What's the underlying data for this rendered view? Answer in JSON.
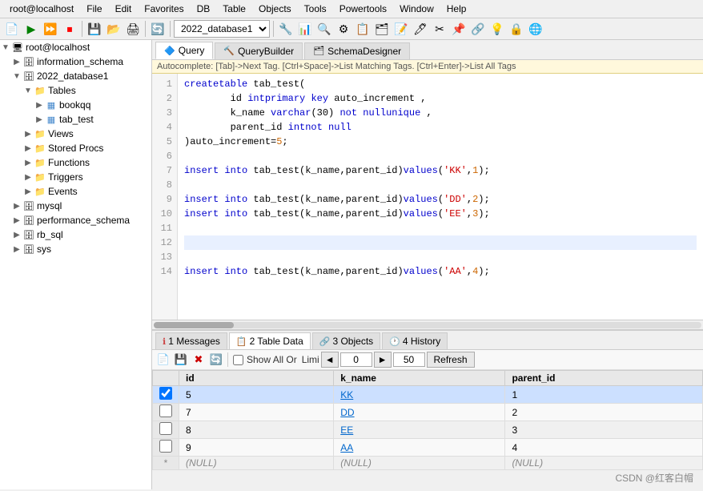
{
  "menubar": {
    "items": [
      "root@localhost",
      "File",
      "Edit",
      "Favorites",
      "DB",
      "Table",
      "Objects",
      "Tools",
      "Powertools",
      "Window",
      "Help"
    ]
  },
  "toolbar": {
    "db_select": "2022_database1"
  },
  "tabs": {
    "query": "Query",
    "query_builder": "QueryBuilder",
    "schema_designer": "SchemaDesigner"
  },
  "autocomplete": "Autocomplete: [Tab]->Next Tag. [Ctrl+Space]->List Matching Tags. [Ctrl+Enter]->List All Tags",
  "code_lines": [
    {
      "num": 1,
      "text": "create table tab_test(",
      "active": false
    },
    {
      "num": 2,
      "text": "        id int primary key auto_increment ,",
      "active": false
    },
    {
      "num": 3,
      "text": "        k_name varchar(30) not null unique ,",
      "active": false
    },
    {
      "num": 4,
      "text": "        parent_id int not null",
      "active": false
    },
    {
      "num": 5,
      "text": ")auto_increment=5;",
      "active": false
    },
    {
      "num": 6,
      "text": "",
      "active": false
    },
    {
      "num": 7,
      "text": "insert into tab_test(k_name,parent_id)values('KK',1);",
      "active": false
    },
    {
      "num": 8,
      "text": "",
      "active": false
    },
    {
      "num": 9,
      "text": "insert into tab_test(k_name,parent_id)values('DD',2);",
      "active": false
    },
    {
      "num": 10,
      "text": "insert into tab_test(k_name,parent_id)values('EE',3);",
      "active": false
    },
    {
      "num": 11,
      "text": "",
      "active": false
    },
    {
      "num": 12,
      "text": "",
      "active": true
    },
    {
      "num": 13,
      "text": "",
      "active": false
    },
    {
      "num": 14,
      "text": "insert into tab_test(k_name,parent_id)values('AA',4);",
      "active": false
    }
  ],
  "sidebar": {
    "items": [
      {
        "id": "root",
        "label": "root@localhost",
        "indent": 0,
        "icon": "server",
        "expanded": true
      },
      {
        "id": "info_schema",
        "label": "information_schema",
        "indent": 1,
        "icon": "db",
        "expanded": false
      },
      {
        "id": "db_2022",
        "label": "2022_database1",
        "indent": 1,
        "icon": "db",
        "expanded": true
      },
      {
        "id": "tables",
        "label": "Tables",
        "indent": 2,
        "icon": "folder",
        "expanded": true
      },
      {
        "id": "bookqq",
        "label": "bookqq",
        "indent": 3,
        "icon": "table",
        "expanded": false
      },
      {
        "id": "tab_test",
        "label": "tab_test",
        "indent": 3,
        "icon": "table",
        "expanded": false
      },
      {
        "id": "views",
        "label": "Views",
        "indent": 2,
        "icon": "folder",
        "expanded": false
      },
      {
        "id": "stored_procs",
        "label": "Stored Procs",
        "indent": 2,
        "icon": "folder",
        "expanded": false
      },
      {
        "id": "functions",
        "label": "Functions",
        "indent": 2,
        "icon": "folder",
        "expanded": false
      },
      {
        "id": "triggers",
        "label": "Triggers",
        "indent": 2,
        "icon": "folder",
        "expanded": false
      },
      {
        "id": "events",
        "label": "Events",
        "indent": 2,
        "icon": "folder",
        "expanded": false
      },
      {
        "id": "mysql",
        "label": "mysql",
        "indent": 1,
        "icon": "db",
        "expanded": false
      },
      {
        "id": "perf_schema",
        "label": "performance_schema",
        "indent": 1,
        "icon": "db",
        "expanded": false
      },
      {
        "id": "rb_sql",
        "label": "rb_sql",
        "indent": 1,
        "icon": "db",
        "expanded": false
      },
      {
        "id": "sys",
        "label": "sys",
        "indent": 1,
        "icon": "db",
        "expanded": false
      }
    ]
  },
  "bottom_tabs": [
    {
      "id": "messages",
      "label": "1 Messages",
      "icon": "ℹ️",
      "active": false
    },
    {
      "id": "table_data",
      "label": "2 Table Data",
      "icon": "📋",
      "active": true
    },
    {
      "id": "objects",
      "label": "3 Objects",
      "icon": "🔗",
      "active": false
    },
    {
      "id": "history",
      "label": "4 History",
      "icon": "🕐",
      "active": false
    }
  ],
  "table_toolbar": {
    "offset_value": "0",
    "limit_value": "50",
    "show_all_label": "Show All Or",
    "limi_label": "Limi",
    "refresh_label": "Refresh"
  },
  "table_data": {
    "columns": [
      "",
      "id",
      "k_name",
      "parent_id"
    ],
    "rows": [
      {
        "id": 5,
        "k_name": "KK",
        "parent_id": 1,
        "selected": true
      },
      {
        "id": 7,
        "k_name": "DD",
        "parent_id": 2,
        "selected": false
      },
      {
        "id": 8,
        "k_name": "EE",
        "parent_id": 3,
        "selected": false
      },
      {
        "id": 9,
        "k_name": "AA",
        "parent_id": 4,
        "selected": false
      }
    ],
    "star_row": {
      "id": "(NULL)",
      "k_name": "(NULL)",
      "parent_id": "(NULL)"
    }
  },
  "watermark": "CSDN @红客白帽"
}
